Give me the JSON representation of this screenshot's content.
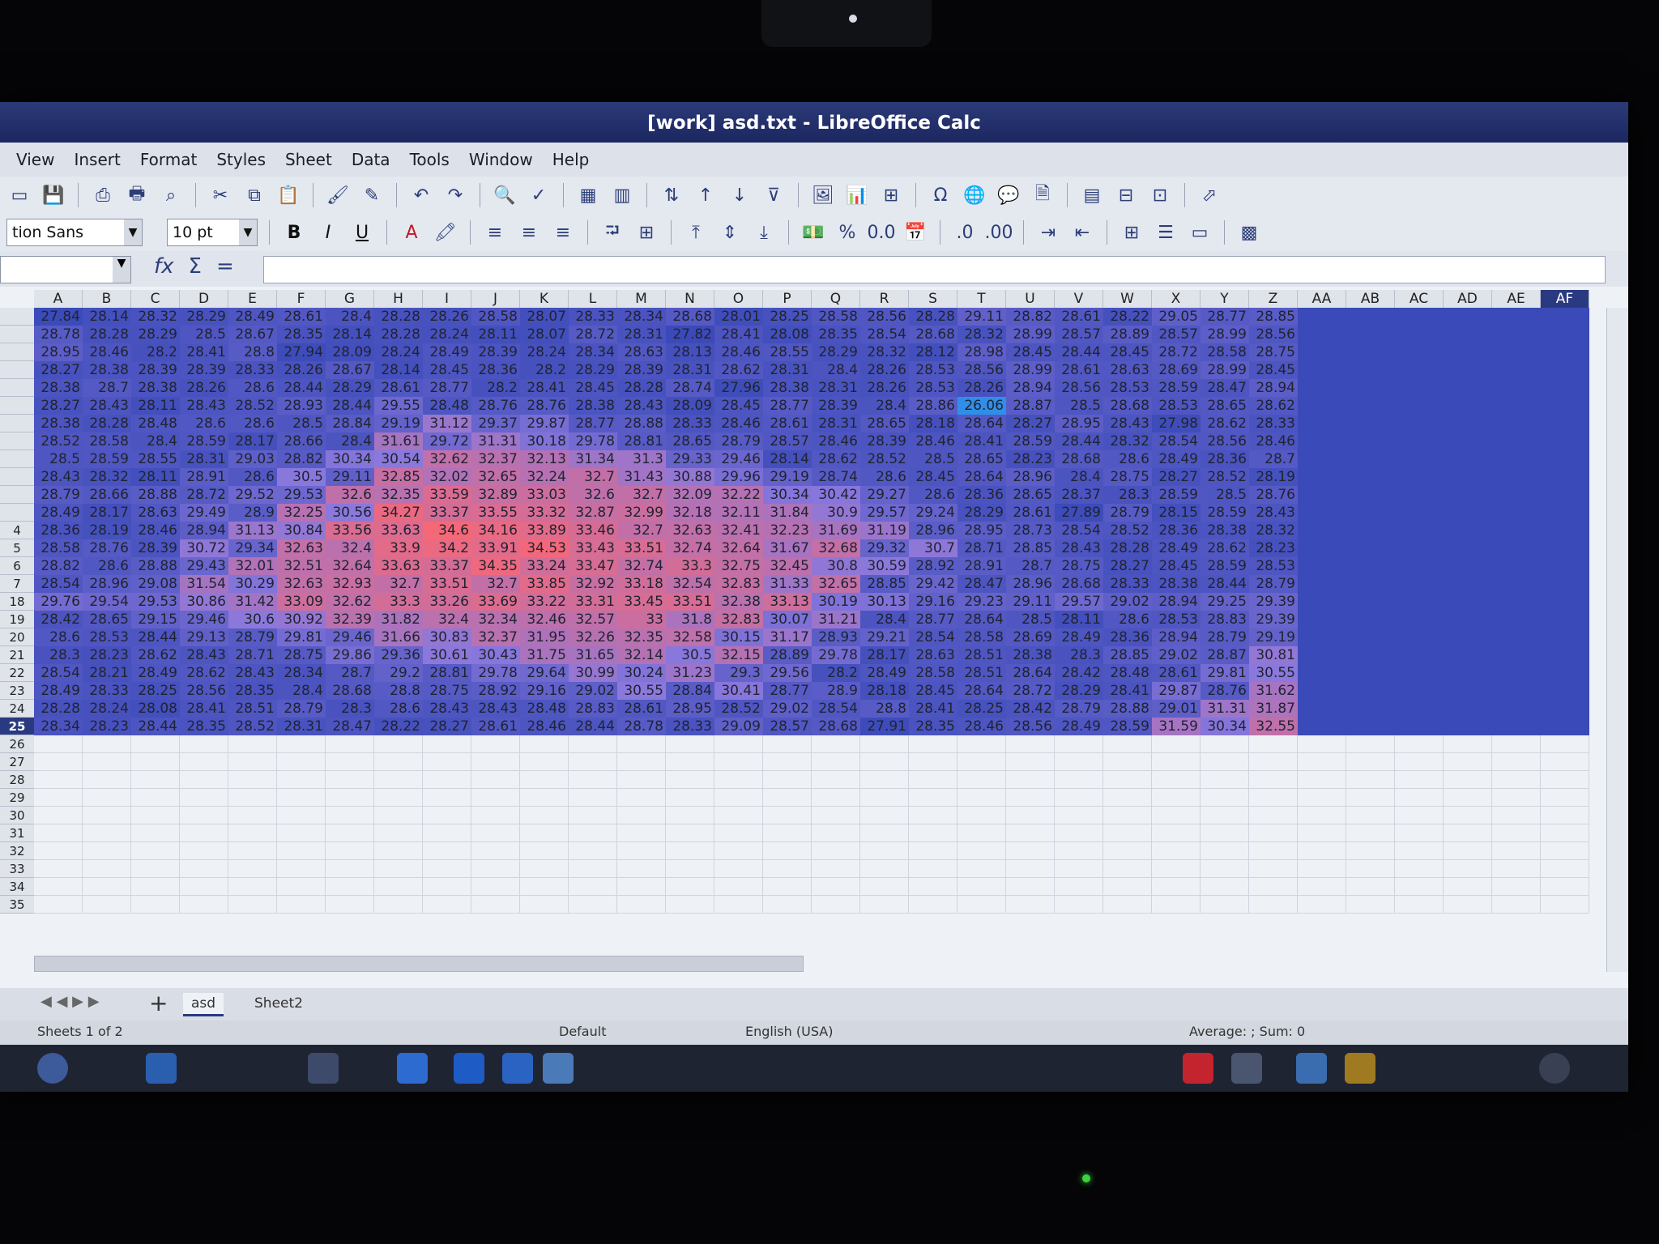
{
  "window": {
    "title": "[work] asd.txt - LibreOffice Calc"
  },
  "menu": [
    "View",
    "Insert",
    "Format",
    "Styles",
    "Sheet",
    "Data",
    "Tools",
    "Window",
    "Help"
  ],
  "toolbar": {
    "font_name": "tion Sans",
    "font_size": "10 pt"
  },
  "formula_bar": {
    "name_box": "",
    "formula": "",
    "fx": "fx",
    "sigma": "Σ",
    "equals": "="
  },
  "columns": [
    "A",
    "B",
    "C",
    "D",
    "E",
    "F",
    "G",
    "H",
    "I",
    "J",
    "K",
    "L",
    "M",
    "N",
    "O",
    "P",
    "Q",
    "R",
    "S",
    "T",
    "U",
    "V",
    "W",
    "X",
    "Y",
    "Z",
    "AA",
    "AB",
    "AC",
    "AD",
    "AE",
    "AF"
  ],
  "selected_column": "AF",
  "row_numbers": [
    "",
    "",
    "",
    "",
    "",
    "",
    "",
    "",
    "",
    "",
    "",
    "",
    "4",
    "5",
    "6",
    "7",
    "18",
    "19",
    "20",
    "21",
    "22",
    "23",
    "24",
    "25",
    "26",
    "27",
    "28",
    "29",
    "30",
    "31",
    "32",
    "33",
    "34",
    "35"
  ],
  "selected_row": "25",
  "rows": [
    [
      "27.84",
      "28.14",
      "28.32",
      "28.29",
      "28.49",
      "28.61",
      "28.4",
      "28.28",
      "28.26",
      "28.58",
      "28.07",
      "28.33",
      "28.34",
      "28.68",
      "28.01",
      "28.25",
      "28.58",
      "28.56",
      "28.28",
      "29.11",
      "28.82",
      "28.61",
      "28.22",
      "29.05",
      "28.77",
      "28.85",
      "",
      "",
      "",
      "",
      "",
      ""
    ],
    [
      "28.78",
      "28.28",
      "28.29",
      "28.5",
      "28.67",
      "28.35",
      "28.14",
      "28.28",
      "28.24",
      "28.11",
      "28.07",
      "28.72",
      "28.31",
      "27.82",
      "28.41",
      "28.08",
      "28.35",
      "28.54",
      "28.68",
      "28.32",
      "28.99",
      "28.57",
      "28.89",
      "28.57",
      "28.99",
      "28.56",
      "",
      "",
      "",
      "",
      "",
      ""
    ],
    [
      "28.95",
      "28.46",
      "28.2",
      "28.41",
      "28.8",
      "27.94",
      "28.09",
      "28.24",
      "28.49",
      "28.39",
      "28.24",
      "28.34",
      "28.63",
      "28.13",
      "28.46",
      "28.55",
      "28.29",
      "28.32",
      "28.12",
      "28.98",
      "28.45",
      "28.44",
      "28.45",
      "28.72",
      "28.58",
      "28.75",
      "",
      "",
      "",
      "",
      "",
      ""
    ],
    [
      "28.27",
      "28.38",
      "28.39",
      "28.39",
      "28.33",
      "28.26",
      "28.67",
      "28.14",
      "28.45",
      "28.36",
      "28.2",
      "28.29",
      "28.39",
      "28.31",
      "28.62",
      "28.31",
      "28.4",
      "28.26",
      "28.53",
      "28.56",
      "28.99",
      "28.61",
      "28.63",
      "28.69",
      "28.99",
      "28.45",
      "",
      "",
      "",
      "",
      "",
      ""
    ],
    [
      "28.38",
      "28.7",
      "28.38",
      "28.26",
      "28.6",
      "28.44",
      "28.29",
      "28.61",
      "28.77",
      "28.2",
      "28.41",
      "28.45",
      "28.28",
      "28.74",
      "27.96",
      "28.38",
      "28.31",
      "28.26",
      "28.53",
      "28.26",
      "28.94",
      "28.56",
      "28.53",
      "28.59",
      "28.47",
      "28.94",
      "",
      "",
      "",
      "",
      "",
      ""
    ],
    [
      "28.27",
      "28.43",
      "28.11",
      "28.43",
      "28.52",
      "28.93",
      "28.44",
      "29.55",
      "28.48",
      "28.76",
      "28.76",
      "28.38",
      "28.43",
      "28.09",
      "28.45",
      "28.77",
      "28.39",
      "28.4",
      "28.86",
      "26.06",
      "28.87",
      "28.5",
      "28.68",
      "28.53",
      "28.65",
      "28.62",
      "",
      "",
      "",
      "",
      "",
      ""
    ],
    [
      "28.38",
      "28.28",
      "28.48",
      "28.6",
      "28.6",
      "28.5",
      "28.84",
      "29.19",
      "31.12",
      "29.37",
      "29.87",
      "28.77",
      "28.88",
      "28.33",
      "28.46",
      "28.61",
      "28.31",
      "28.65",
      "28.18",
      "28.64",
      "28.27",
      "28.95",
      "28.43",
      "27.98",
      "28.62",
      "28.33",
      "",
      "",
      "",
      "",
      "",
      ""
    ],
    [
      "28.52",
      "28.58",
      "28.4",
      "28.59",
      "28.17",
      "28.66",
      "28.4",
      "31.61",
      "29.72",
      "31.31",
      "30.18",
      "29.78",
      "28.81",
      "28.65",
      "28.79",
      "28.57",
      "28.46",
      "28.39",
      "28.46",
      "28.41",
      "28.59",
      "28.44",
      "28.32",
      "28.54",
      "28.56",
      "28.46",
      "",
      "",
      "",
      "",
      "",
      ""
    ],
    [
      "28.5",
      "28.59",
      "28.55",
      "28.31",
      "29.03",
      "28.82",
      "30.34",
      "30.54",
      "32.62",
      "32.37",
      "32.13",
      "31.34",
      "31.3",
      "29.33",
      "29.46",
      "28.14",
      "28.62",
      "28.52",
      "28.5",
      "28.65",
      "28.23",
      "28.68",
      "28.6",
      "28.49",
      "28.36",
      "28.7",
      "",
      "",
      "",
      "",
      "",
      ""
    ],
    [
      "28.43",
      "28.32",
      "28.11",
      "28.91",
      "28.6",
      "30.5",
      "29.11",
      "32.85",
      "32.02",
      "32.65",
      "32.24",
      "32.7",
      "31.43",
      "30.88",
      "29.96",
      "29.19",
      "28.74",
      "28.6",
      "28.45",
      "28.64",
      "28.96",
      "28.4",
      "28.75",
      "28.27",
      "28.52",
      "28.19",
      "",
      "",
      "",
      "",
      "",
      ""
    ],
    [
      "28.79",
      "28.66",
      "28.88",
      "28.72",
      "29.52",
      "29.53",
      "32.6",
      "32.35",
      "33.59",
      "32.89",
      "33.03",
      "32.6",
      "32.7",
      "32.09",
      "32.22",
      "30.34",
      "30.42",
      "29.27",
      "28.6",
      "28.36",
      "28.65",
      "28.37",
      "28.3",
      "28.59",
      "28.5",
      "28.76",
      "",
      "",
      "",
      "",
      "",
      ""
    ],
    [
      "28.49",
      "28.17",
      "28.63",
      "29.49",
      "28.9",
      "32.25",
      "30.56",
      "34.27",
      "33.37",
      "33.55",
      "33.32",
      "32.87",
      "32.99",
      "32.18",
      "32.11",
      "31.84",
      "30.9",
      "29.57",
      "29.24",
      "28.29",
      "28.61",
      "27.89",
      "28.79",
      "28.15",
      "28.59",
      "28.43",
      "",
      "",
      "",
      "",
      "",
      ""
    ],
    [
      "28.36",
      "28.19",
      "28.46",
      "28.94",
      "31.13",
      "30.84",
      "33.56",
      "33.63",
      "34.6",
      "34.16",
      "33.89",
      "33.46",
      "32.7",
      "32.63",
      "32.41",
      "32.23",
      "31.69",
      "31.19",
      "28.96",
      "28.95",
      "28.73",
      "28.54",
      "28.52",
      "28.36",
      "28.38",
      "28.32",
      "",
      "",
      "",
      "",
      "",
      ""
    ],
    [
      "28.58",
      "28.76",
      "28.39",
      "30.72",
      "29.34",
      "32.63",
      "32.4",
      "33.9",
      "34.2",
      "33.91",
      "34.53",
      "33.43",
      "33.51",
      "32.74",
      "32.64",
      "31.67",
      "32.68",
      "29.32",
      "30.7",
      "28.71",
      "28.85",
      "28.43",
      "28.28",
      "28.49",
      "28.62",
      "28.23",
      "",
      "",
      "",
      "",
      "",
      ""
    ],
    [
      "28.82",
      "28.6",
      "28.88",
      "29.43",
      "32.01",
      "32.51",
      "32.64",
      "33.63",
      "33.37",
      "34.35",
      "33.24",
      "33.47",
      "32.74",
      "33.3",
      "32.75",
      "32.45",
      "30.8",
      "30.59",
      "28.92",
      "28.91",
      "28.7",
      "28.75",
      "28.27",
      "28.45",
      "28.59",
      "28.53",
      "",
      "",
      "",
      "",
      "",
      ""
    ],
    [
      "28.54",
      "28.96",
      "29.08",
      "31.54",
      "30.29",
      "32.63",
      "32.93",
      "32.7",
      "33.51",
      "32.7",
      "33.85",
      "32.92",
      "33.18",
      "32.54",
      "32.83",
      "31.33",
      "32.65",
      "28.85",
      "29.42",
      "28.47",
      "28.96",
      "28.68",
      "28.33",
      "28.38",
      "28.44",
      "28.79",
      "",
      "",
      "",
      "",
      "",
      ""
    ],
    [
      "29.76",
      "29.54",
      "29.53",
      "30.86",
      "31.42",
      "33.09",
      "32.62",
      "33.3",
      "33.26",
      "33.69",
      "33.22",
      "33.31",
      "33.45",
      "33.51",
      "32.38",
      "33.13",
      "30.19",
      "30.13",
      "29.16",
      "29.23",
      "29.11",
      "29.57",
      "29.02",
      "28.94",
      "29.25",
      "29.39",
      "",
      "",
      "",
      "",
      "",
      ""
    ],
    [
      "28.42",
      "28.65",
      "29.15",
      "29.46",
      "30.6",
      "30.92",
      "32.39",
      "31.82",
      "32.4",
      "32.34",
      "32.46",
      "32.57",
      "33",
      "31.8",
      "32.83",
      "30.07",
      "31.21",
      "28.4",
      "28.77",
      "28.64",
      "28.5",
      "28.11",
      "28.6",
      "28.53",
      "28.83",
      "29.39",
      "",
      "",
      "",
      "",
      "",
      ""
    ],
    [
      "28.6",
      "28.53",
      "28.44",
      "29.13",
      "28.79",
      "29.81",
      "29.46",
      "31.66",
      "30.83",
      "32.37",
      "31.95",
      "32.26",
      "32.35",
      "32.58",
      "30.15",
      "31.17",
      "28.93",
      "29.21",
      "28.54",
      "28.58",
      "28.69",
      "28.49",
      "28.36",
      "28.94",
      "28.79",
      "29.19",
      "",
      "",
      "",
      "",
      "",
      ""
    ],
    [
      "28.3",
      "28.23",
      "28.62",
      "28.43",
      "28.71",
      "28.75",
      "29.86",
      "29.36",
      "30.61",
      "30.43",
      "31.75",
      "31.65",
      "32.14",
      "30.5",
      "32.15",
      "28.89",
      "29.78",
      "28.17",
      "28.63",
      "28.51",
      "28.38",
      "28.3",
      "28.85",
      "29.02",
      "28.87",
      "30.81",
      "",
      "",
      "",
      "",
      "",
      ""
    ],
    [
      "28.54",
      "28.21",
      "28.49",
      "28.62",
      "28.43",
      "28.34",
      "28.7",
      "29.2",
      "28.81",
      "29.78",
      "29.64",
      "30.99",
      "30.24",
      "31.23",
      "29.3",
      "29.56",
      "28.2",
      "28.49",
      "28.58",
      "28.51",
      "28.64",
      "28.42",
      "28.48",
      "28.61",
      "29.81",
      "30.55",
      "",
      "",
      "",
      "",
      "",
      ""
    ],
    [
      "28.49",
      "28.33",
      "28.25",
      "28.56",
      "28.35",
      "28.4",
      "28.68",
      "28.8",
      "28.75",
      "28.92",
      "29.16",
      "29.02",
      "30.55",
      "28.84",
      "30.41",
      "28.77",
      "28.9",
      "28.18",
      "28.45",
      "28.64",
      "28.72",
      "28.29",
      "28.41",
      "29.87",
      "28.76",
      "31.62",
      "",
      "",
      "",
      "",
      "",
      ""
    ],
    [
      "28.28",
      "28.24",
      "28.08",
      "28.41",
      "28.51",
      "28.79",
      "28.3",
      "28.6",
      "28.43",
      "28.43",
      "28.48",
      "28.83",
      "28.61",
      "28.95",
      "28.52",
      "29.02",
      "28.54",
      "28.8",
      "28.41",
      "28.25",
      "28.42",
      "28.79",
      "28.88",
      "29.01",
      "31.31",
      "31.87",
      "",
      "",
      "",
      "",
      "",
      ""
    ],
    [
      "28.34",
      "28.23",
      "28.44",
      "28.35",
      "28.52",
      "28.31",
      "28.47",
      "28.22",
      "28.27",
      "28.61",
      "28.46",
      "28.44",
      "28.78",
      "28.33",
      "29.09",
      "28.57",
      "28.68",
      "27.91",
      "28.35",
      "28.46",
      "28.56",
      "28.49",
      "28.59",
      "31.59",
      "30.34",
      "32.55",
      "",
      "",
      "",
      "",
      "",
      ""
    ]
  ],
  "sheet_tabs": [
    "asd",
    "Sheet2"
  ],
  "active_tab": "asd",
  "status": {
    "sheet": "Sheets 1 of 2",
    "page_style": "Default",
    "language": "English (USA)",
    "sum": "Average: ; Sum: 0"
  },
  "colors": {
    "low": "#3a4ab8",
    "mid": "#6a6fd8",
    "high": "#f06a7a",
    "selected": "#2a3a80"
  }
}
